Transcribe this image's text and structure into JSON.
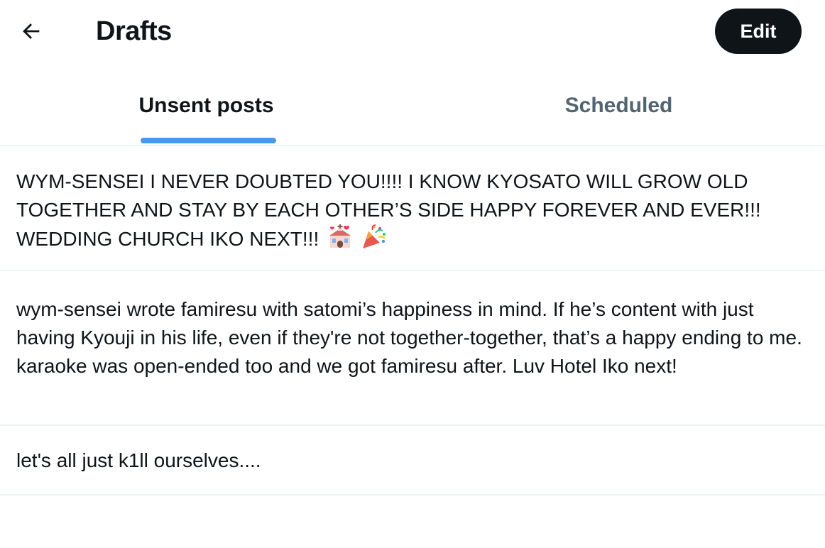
{
  "header": {
    "back_icon": "arrow-left-icon",
    "title": "Drafts",
    "edit_label": "Edit"
  },
  "tabs": [
    {
      "label": "Unsent posts",
      "active": true
    },
    {
      "label": "Scheduled",
      "active": false
    }
  ],
  "drafts": [
    {
      "text": "WYM-SENSEI I NEVER DOUBTED YOU!!!! I KNOW KYOSATO WILL GROW OLD TOGETHER AND STAY BY EACH OTHER’S SIDE HAPPY FOREVER AND EVER!!! WEDDING CHURCH IKO NEXT!!!",
      "emojis": [
        "wedding-icon",
        "party-popper-icon"
      ]
    },
    {
      "text": "wym-sensei wrote famiresu with satomi’s happiness in mind. If he’s content with just having Kyouji in his life, even if they're not together-together, that’s a happy ending to me. karaoke was open-ended too and we got famiresu after. Luv Hotel Iko next!"
    },
    {
      "text": "let's all just k1ll ourselves...."
    }
  ],
  "colors": {
    "text": "#0f1419",
    "muted": "#536471",
    "accent": "#4a99e9",
    "divider": "#eff3f4"
  }
}
